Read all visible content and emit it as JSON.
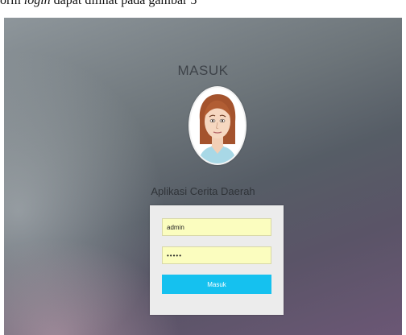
{
  "caption": {
    "prefix": "orm ",
    "italic": "login",
    "suffix": " dapat dilihat pada gambar 5"
  },
  "screen": {
    "title": "MASUK",
    "app_name": "Aplikasi Cerita Daerah",
    "avatar_icon": "female-face-avatar",
    "form": {
      "username_value": "admin",
      "password_value": "•••••",
      "submit_label": "Masuk"
    }
  }
}
